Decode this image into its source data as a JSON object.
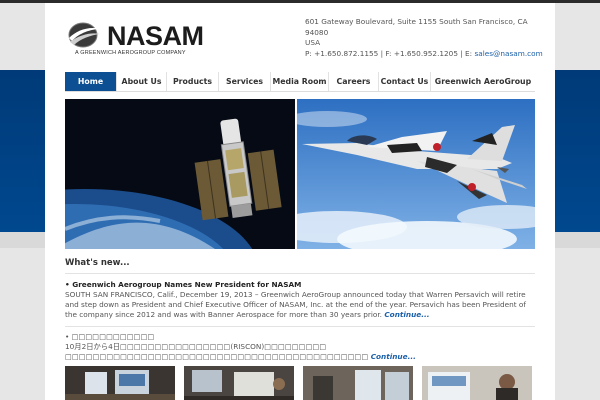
{
  "header": {
    "logo_text": "NASAM",
    "logo_tagline": "A GREENWICH AEROGROUP COMPANY",
    "address_line1": "601 Gateway Boulevard, Suite 1155 South San Francisco, CA 94080",
    "address_line2": "USA",
    "contact_phones": "P: +1.650.872.1155 | F: +1.650.952.1205 | E: ",
    "contact_email": "sales@nasam.com"
  },
  "nav": {
    "items": [
      {
        "label": "Home",
        "active": true
      },
      {
        "label": "About Us"
      },
      {
        "label": "Products"
      },
      {
        "label": "Services"
      },
      {
        "label": "Media Room"
      },
      {
        "label": "Careers"
      },
      {
        "label": "Contact Us"
      },
      {
        "label": "Greenwich AeroGroup"
      }
    ]
  },
  "main": {
    "section_title": "What's new...",
    "news": [
      {
        "headline": "• Greenwich Aerogroup Names New President for NASAM",
        "body": "SOUTH SAN FRANCISCO, Calif., December 19, 2013 – Greenwich AeroGroup announced today that Warren Persavich will retire and step down as President and Chief Executive Officer of NASAM, Inc. at the end of the year. Persavich has been President of the company since 2012 and was with Banner Aerospace for more than 30 years prior.",
        "more": "Continue..."
      },
      {
        "headline": "• □□□□□□□□□□□□",
        "body": "10月2日から4日□□□□□□□□□□□□□□□□(RISCON)□□□□□□□□□",
        "body2": "□□□□□□□□□□□□□□□□□□□□□□□□□□□□□□□□□□□□□□□□□□□□",
        "more": "Continue..."
      }
    ]
  },
  "colors": {
    "brand_blue": "#0c4f93",
    "link_blue": "#1a5fa8",
    "side_band": "#003a78"
  }
}
